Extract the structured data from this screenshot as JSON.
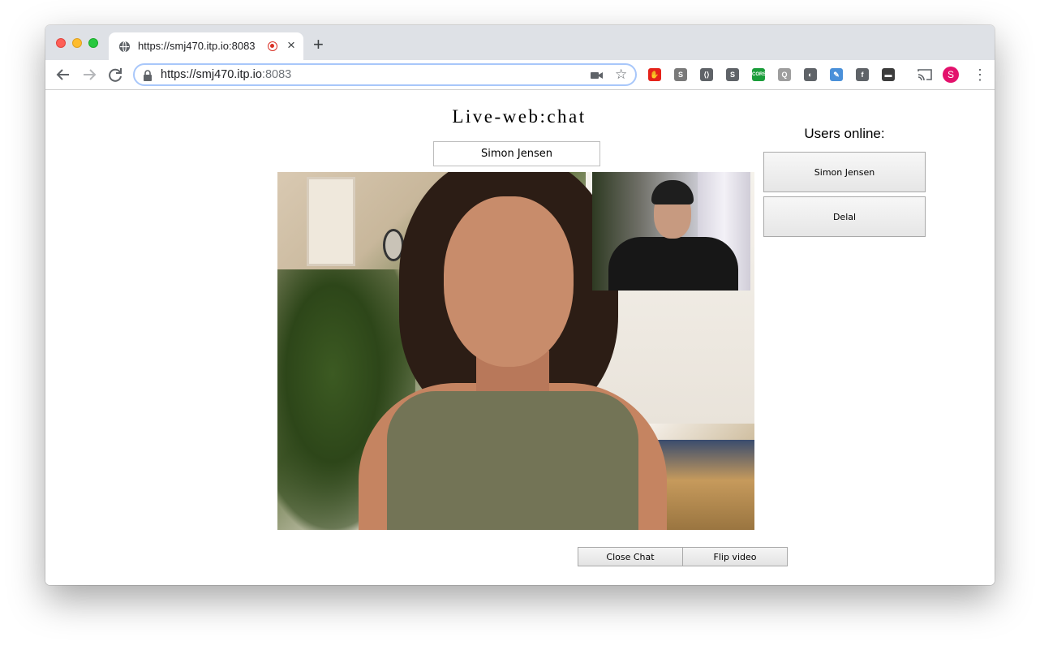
{
  "browser": {
    "tab": {
      "title": "https://smj470.itp.io:8083",
      "close_glyph": "×",
      "recording_icon": "recording-dot-icon"
    },
    "new_tab_glyph": "+",
    "omnibox": {
      "url_scheme_host": "https://smj470.itp.io",
      "url_port": ":8083",
      "star_glyph": "☆"
    },
    "nav": {
      "back_icon": "arrow-left-icon",
      "forward_icon": "arrow-right-icon",
      "reload_icon": "reload-icon"
    },
    "extensions": [
      {
        "name": "adblock-extension",
        "color": "#e5231b",
        "glyph": "✋"
      },
      {
        "name": "s-extension",
        "color": "#7a7a7a",
        "glyph": "S"
      },
      {
        "name": "code-extension",
        "color": "#5f6368",
        "glyph": "⟨⟩"
      },
      {
        "name": "skype-extension",
        "color": "#5f6368",
        "glyph": "S"
      },
      {
        "name": "cors-extension",
        "color": "#1a9d3a",
        "glyph": "CORS"
      },
      {
        "name": "chat-extension",
        "color": "#9e9e9e",
        "glyph": "Q"
      },
      {
        "name": "circle-extension",
        "color": "#5f6368",
        "glyph": "◐"
      },
      {
        "name": "feather-extension",
        "color": "#4a90d9",
        "glyph": "✎"
      },
      {
        "name": "facebook-extension",
        "color": "#5f6368",
        "glyph": "f"
      },
      {
        "name": "dark-extension",
        "color": "#3c3c3c",
        "glyph": "▬"
      }
    ],
    "profile_initial": "S",
    "profile_color": "#e3116c"
  },
  "page": {
    "title": "Live-web:chat",
    "name_input_value": "Simon Jensen",
    "users_title": "Users online:",
    "users": [
      "Simon Jensen",
      "Delal"
    ],
    "close_chat_label": "Close Chat",
    "flip_video_label": "Flip video"
  }
}
